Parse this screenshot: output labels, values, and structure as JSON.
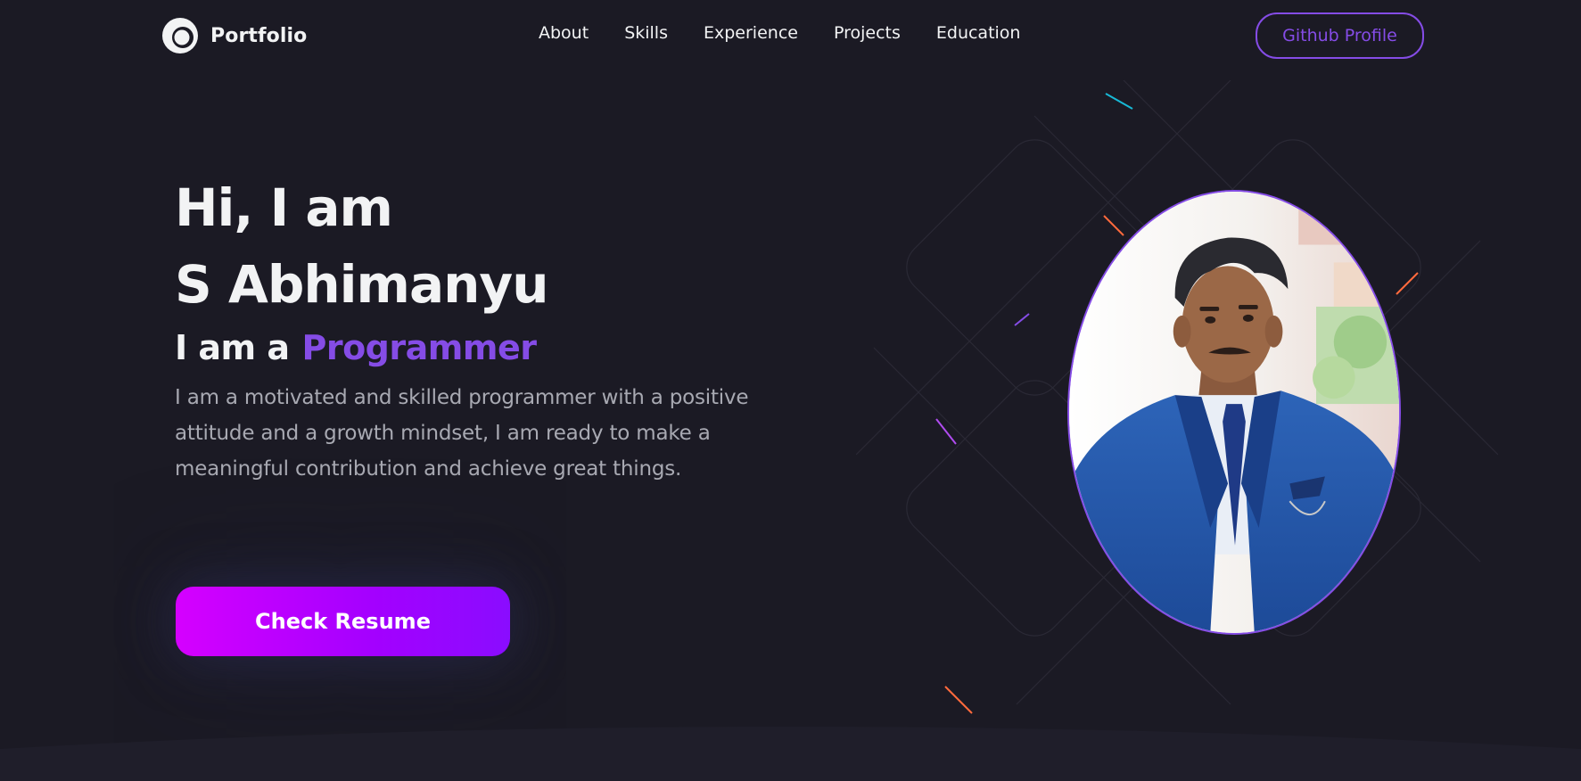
{
  "nav": {
    "logo_text": "Portfolio",
    "links": [
      "About",
      "Skills",
      "Experience",
      "Projects",
      "Education"
    ],
    "cta_label": "Github Profile"
  },
  "hero": {
    "greeting": "Hi, I am",
    "name": "S Abhimanyu",
    "role_prefix": "I am a",
    "role": "Programmer",
    "description": "I am a motivated and skilled programmer with a positive attitude and a growth mindset, I am ready to make a meaningful contribution and achieve great things.",
    "resume_label": "Check Resume"
  },
  "icons": [
    "logo-icon"
  ],
  "colors": {
    "background": "#1b1a24",
    "accent": "#854ce6",
    "text_primary": "#f2f3f4",
    "text_secondary": "#a8a9b2",
    "button_gradient_start": "#d500ff",
    "button_gradient_end": "#8a0cff"
  }
}
